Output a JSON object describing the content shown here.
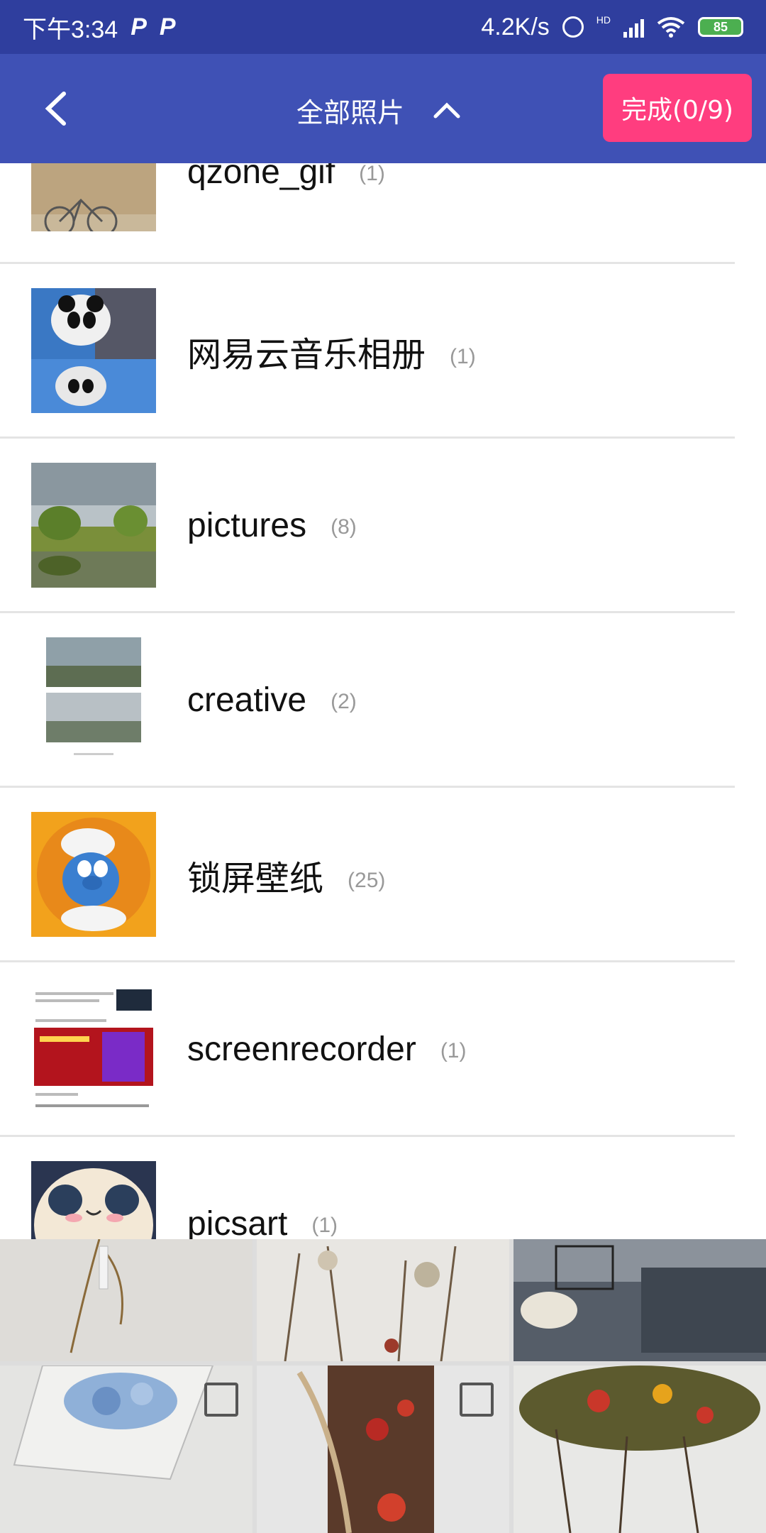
{
  "status": {
    "time": "下午3:34",
    "p1": "P",
    "p2": "P",
    "speed": "4.2K/s",
    "hd": "HD",
    "battery": "85"
  },
  "appbar": {
    "title": "全部照片",
    "done_label": "完成(0/9)"
  },
  "albums": [
    {
      "name": "qzone_gif",
      "count": "(1)"
    },
    {
      "name": "网易云音乐相册",
      "count": "(1)"
    },
    {
      "name": "pictures",
      "count": "(8)"
    },
    {
      "name": "creative",
      "count": "(2)"
    },
    {
      "name": "锁屏壁纸",
      "count": "(25)"
    },
    {
      "name": "screenrecorder",
      "count": "(1)"
    },
    {
      "name": "picsart",
      "count": "(1)"
    }
  ],
  "colors": {
    "statusbar": "#2f3e9e",
    "appbar": "#3f51b5",
    "accent": "#ff3d7f"
  }
}
